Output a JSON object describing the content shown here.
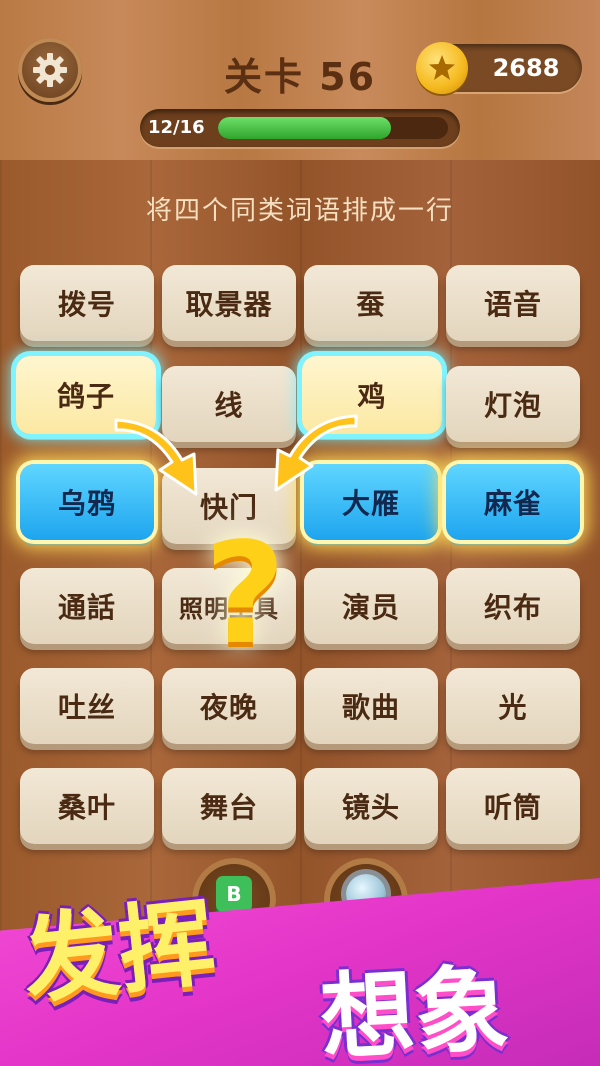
{
  "header": {
    "level_title": "关卡 56",
    "coins": "2688",
    "progress_text": "12/16",
    "progress_fraction": 0.75
  },
  "instruction": "将四个同类词语排成一行",
  "tiles": [
    {
      "label": "拨号"
    },
    {
      "label": "取景器"
    },
    {
      "label": "蚕"
    },
    {
      "label": "语音"
    },
    {
      "label": "鸽子"
    },
    {
      "label": "线"
    },
    {
      "label": "鸡"
    },
    {
      "label": "灯泡"
    },
    {
      "label": "乌鸦"
    },
    {
      "label": "快门"
    },
    {
      "label": "大雁"
    },
    {
      "label": "麻雀"
    },
    {
      "label": "通話"
    },
    {
      "label": "照明工具"
    },
    {
      "label": "演员"
    },
    {
      "label": "织布"
    },
    {
      "label": "吐丝"
    },
    {
      "label": "夜晚"
    },
    {
      "label": "歌曲"
    },
    {
      "label": "光"
    },
    {
      "label": "桑叶"
    },
    {
      "label": "舞台"
    },
    {
      "label": "镜头"
    },
    {
      "label": "听筒"
    }
  ],
  "hint_symbol": "?",
  "booster_label": "B",
  "banner": {
    "left": "发挥",
    "right": "想象"
  },
  "colors": {
    "selected_glow": "#7ff3ff",
    "blue_tile": "#1ea5ef",
    "banner_bg": "#e335c8",
    "progress_fill": "#2fa52c"
  },
  "icons": {
    "settings": "gear-icon",
    "coin": "star-coin-icon",
    "hint": "question-mark-icon",
    "booster": "letter-block-icon",
    "magnifier": "magnifier-icon"
  }
}
